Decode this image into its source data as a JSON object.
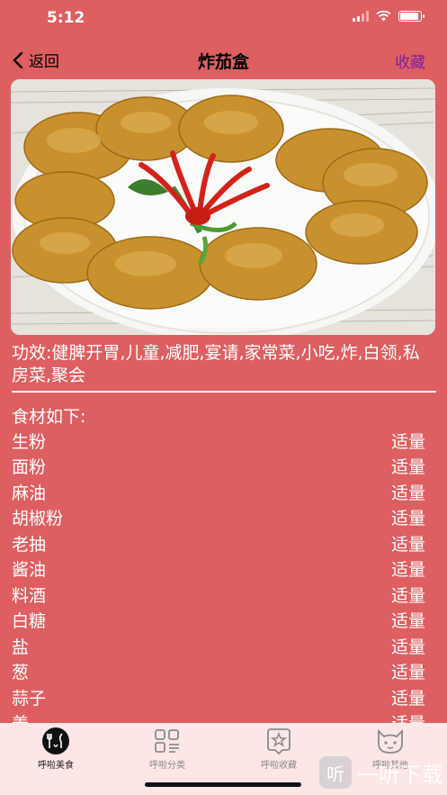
{
  "status": {
    "time": "5:12"
  },
  "nav": {
    "back_label": "返回",
    "title": "炸茄盒",
    "favorite_label": "收藏"
  },
  "recipe": {
    "effects": "功效:健脾开胃,儿童,减肥,宴请,家常菜,小吃,炸,白领,私房菜,聚会",
    "ingredients_title": "食材如下:",
    "ingredients": [
      {
        "name": "生粉",
        "amount": "适量"
      },
      {
        "name": "面粉",
        "amount": "适量"
      },
      {
        "name": "麻油",
        "amount": "适量"
      },
      {
        "name": "胡椒粉",
        "amount": "适量"
      },
      {
        "name": "老抽",
        "amount": "适量"
      },
      {
        "name": "酱油",
        "amount": "适量"
      },
      {
        "name": "料酒",
        "amount": "适量"
      },
      {
        "name": "白糖",
        "amount": "适量"
      },
      {
        "name": "盐",
        "amount": "适量"
      },
      {
        "name": "葱",
        "amount": "适量"
      },
      {
        "name": "蒜子",
        "amount": "适量"
      },
      {
        "name": "姜",
        "amount": "适量"
      }
    ]
  },
  "tabs": [
    {
      "label": "呼啦美食",
      "icon": "food-icon"
    },
    {
      "label": "呼啦分类",
      "icon": "category-icon"
    },
    {
      "label": "呼啦收藏",
      "icon": "star-icon"
    },
    {
      "label": "呼啦其他",
      "icon": "cat-icon"
    }
  ],
  "watermark": {
    "text": "一听下载"
  },
  "colors": {
    "background": "#de5f61",
    "favorite": "#7b1fa2",
    "tabbar": "#fde6e6"
  }
}
